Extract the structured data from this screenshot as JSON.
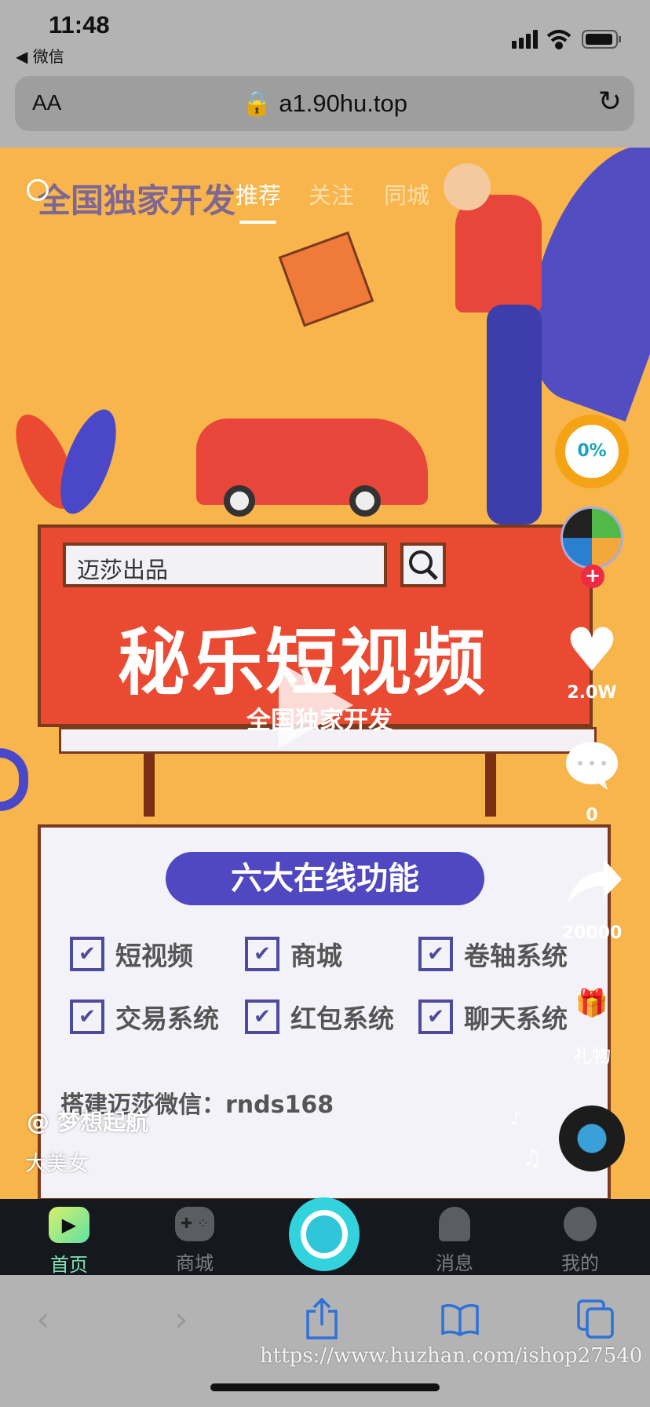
{
  "status_bar": {
    "time": "11:48",
    "back_app": "◀ 微信"
  },
  "browser": {
    "text_size": "AA",
    "url": "a1.90hu.top"
  },
  "overlay": {
    "title": "全国独家开发",
    "tabs": [
      {
        "label": "推荐",
        "active": true
      },
      {
        "label": "关注"
      },
      {
        "label": "同城"
      }
    ]
  },
  "poster": {
    "search_text": "迈莎出品",
    "title": "秘乐短视频",
    "subtitle": "全国独家开发",
    "features_heading": "六大在线功能",
    "features": [
      "短视频",
      "商城",
      "卷轴系统",
      "交易系统",
      "红包系统",
      "聊天系统"
    ],
    "contact": "搭建迈莎微信：rnds168"
  },
  "video": {
    "author": "@ 梦想起航",
    "description": "大美女"
  },
  "actions": {
    "progress": "0%",
    "likes": "2.0W",
    "comments": "0",
    "shares": "20000",
    "gift_label": "礼物"
  },
  "tabbar": [
    {
      "label": "首页",
      "active": true
    },
    {
      "label": "商城"
    },
    {
      "label": "消息"
    },
    {
      "label": "我的"
    }
  ],
  "watermark": "https://www.huzhan.com/ishop27540",
  "colors": {
    "accent": "#7ee2b8",
    "poster_bg": "#f7b54c",
    "board_red": "#ea4a31",
    "pill": "#4f48c0",
    "safari_blue": "#2e72d8"
  }
}
